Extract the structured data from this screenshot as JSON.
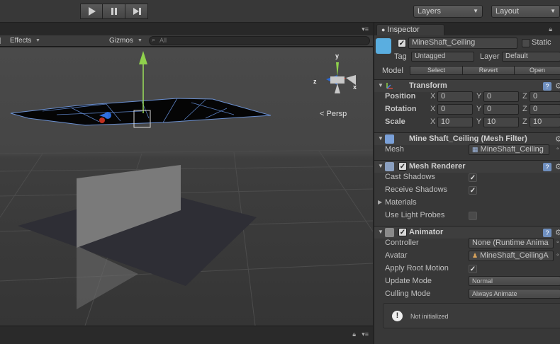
{
  "toolbar": {
    "layers_label": "Layers",
    "layout_label": "Layout",
    "play_icon": "play-icon",
    "pause_icon": "pause-icon",
    "step_icon": "step-icon"
  },
  "scene": {
    "effects_label": "Effects",
    "gizmos_label": "Gizmos",
    "search_placeholder": "All",
    "persp_label": "Persp",
    "gizmo_axes": {
      "y": "y",
      "x": "x",
      "z": "z"
    }
  },
  "inspector": {
    "tab_label": "Inspector",
    "object": {
      "name": "MineShaft_Ceiling",
      "static_label": "Static",
      "tag_label": "Tag",
      "tag_value": "Untagged",
      "layer_label": "Layer",
      "layer_value": "Default",
      "model_label": "Model",
      "select_label": "Select",
      "revert_label": "Revert",
      "open_label": "Open"
    },
    "transform": {
      "title": "Transform",
      "position_label": "Position",
      "rotation_label": "Rotation",
      "scale_label": "Scale",
      "x": "X",
      "y": "Y",
      "z": "Z",
      "position": [
        "0",
        "0",
        "0"
      ],
      "rotation": [
        "0",
        "0",
        "0"
      ],
      "scale": [
        "10",
        "10",
        "10"
      ]
    },
    "mesh_filter": {
      "title": "Mine Shaft_Ceiling (Mesh Filter)",
      "mesh_label": "Mesh",
      "mesh_value": "MineShaft_Ceiling"
    },
    "mesh_renderer": {
      "title": "Mesh Renderer",
      "cast_shadows": "Cast Shadows",
      "receive_shadows": "Receive Shadows",
      "materials": "Materials",
      "use_light_probes": "Use Light Probes"
    },
    "animator": {
      "title": "Animator",
      "controller_label": "Controller",
      "controller_value": "None (Runtime Anima",
      "avatar_label": "Avatar",
      "avatar_value": "MineShaft_CeilingA",
      "apply_root_motion": "Apply Root Motion",
      "update_mode_label": "Update Mode",
      "update_mode_value": "Normal",
      "culling_mode_label": "Culling Mode",
      "culling_mode_value": "Always Animate",
      "status": "Not initialized"
    }
  }
}
